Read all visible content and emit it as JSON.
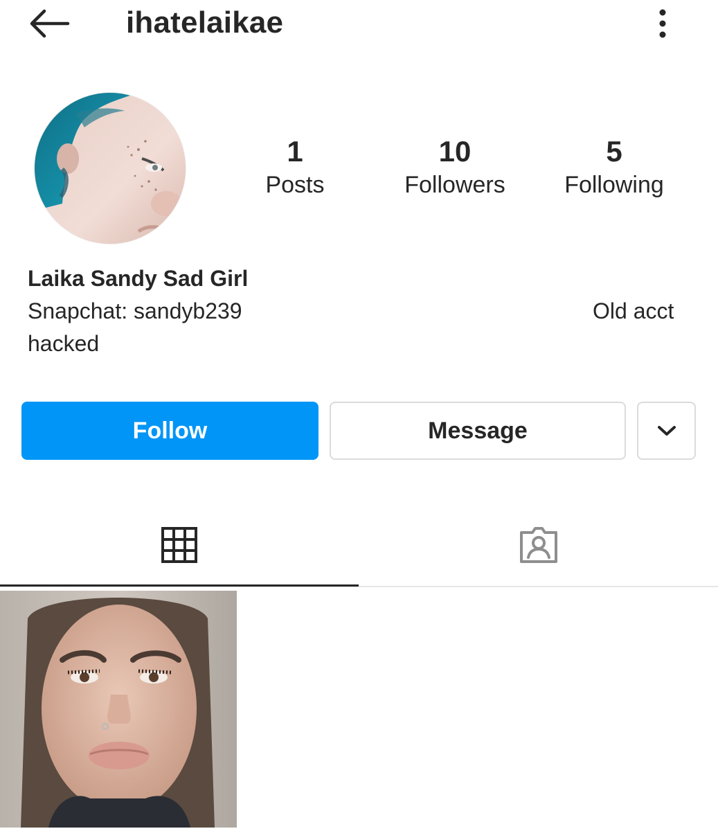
{
  "header": {
    "username": "ihatelaikae",
    "back_icon": "arrow-left-icon",
    "more_icon": "more-vertical-icon"
  },
  "profile": {
    "avatar": "profile-avatar",
    "stats": {
      "posts": {
        "value": "1",
        "label": "Posts"
      },
      "followers": {
        "value": "10",
        "label": "Followers"
      },
      "following": {
        "value": "5",
        "label": "Following"
      }
    }
  },
  "bio": {
    "name": "Laika Sandy Sad Girl",
    "snapchat": "Snapchat: sandyb239",
    "old_acct": "Old acct",
    "hacked": "hacked"
  },
  "actions": {
    "follow_label": "Follow",
    "message_label": "Message",
    "suggest_icon": "chevron-down-icon"
  },
  "tabs": {
    "grid_icon": "grid-icon",
    "tagged_icon": "tagged-person-icon"
  },
  "colors": {
    "accent": "#0095f6",
    "text": "#262626",
    "border": "#dbdbdb"
  }
}
